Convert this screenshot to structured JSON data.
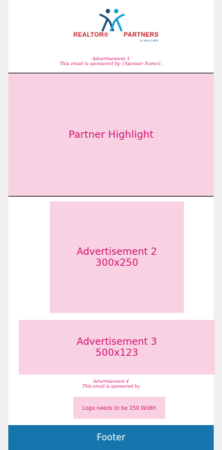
{
  "header": {
    "logo": {
      "left_text": "REALTOR®",
      "right_text": "PARTNERS",
      "sub_text": "NC REALTORS®",
      "colors": {
        "red": "#c0202a",
        "blue": "#1f4f7a",
        "teal": "#16a2d2"
      }
    },
    "advertisement_1": {
      "title": "Advertisement 1",
      "sponsor_line": "This email is sponsored by {Sponsor Name}."
    }
  },
  "partner_highlight": {
    "label": "Partner Highlight"
  },
  "advertisement_2": {
    "line1": "Advertisement 2",
    "line2": "300x250"
  },
  "advertisement_3": {
    "line1": "Advertisement 3",
    "line2": "500x123"
  },
  "advertisement_4": {
    "title": "Advertisement 4",
    "sponsor_line": "This email is sponsored by",
    "logo_placeholder": "Logo needs to be 150 Width"
  },
  "footer": {
    "label": "Footer"
  },
  "colors": {
    "page_bg": "#efefef",
    "content_bg": "#ffffff",
    "placeholder_bg": "#f8d2e3",
    "placeholder_text": "#d4106e",
    "footer_bg": "#1576ad"
  }
}
